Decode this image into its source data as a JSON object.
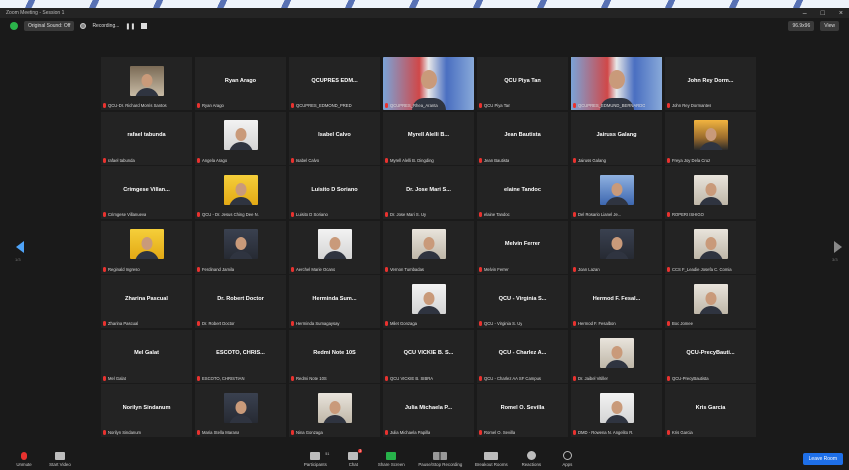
{
  "window": {
    "title": "Zoom Meeting - Session 1",
    "controls": [
      "–",
      "□",
      "×"
    ]
  },
  "toolbar_top": {
    "original_sound": "Original Sound: Off",
    "recording": "Recording...",
    "zoom_level": "96.9x96",
    "view": "View"
  },
  "nav": {
    "left_page": "1/3",
    "right_page": "3/3"
  },
  "tiles": [
    {
      "type": "photo",
      "style": "p-room",
      "label": "QCU-Dr. Richard Morris Santos"
    },
    {
      "type": "name",
      "name": "Ryan Arago",
      "label": "Ryan Arago"
    },
    {
      "type": "name",
      "name": "QCUPRES EDM...",
      "label": "QCUPRES_EDMOND_PRED"
    },
    {
      "type": "photo",
      "style": "p-seal",
      "label": "QCUPRES_Rhea_Aranta",
      "wide": true
    },
    {
      "type": "name",
      "name": "QCU Piya Tan",
      "label": "QCU Piya Tan"
    },
    {
      "type": "photo",
      "style": "p-seal",
      "label": "QCUPRES_EDMUND_BERNARDO",
      "wide": true,
      "active": true
    },
    {
      "type": "name",
      "name": "John Rey Dorm...",
      "label": "John Rey Dormantes"
    },
    {
      "type": "name",
      "name": "rafael tabunda",
      "label": "rafael tabunda"
    },
    {
      "type": "photo",
      "style": "p-white",
      "label": "Angela Arago"
    },
    {
      "type": "name",
      "name": "Isabel Calvo",
      "label": "Isabel Calvo"
    },
    {
      "type": "name",
      "name": "Myrell Alelli B...",
      "label": "Myrell Alelli B. Dingding"
    },
    {
      "type": "name",
      "name": "Jean Bautista",
      "label": "Jean Bautista"
    },
    {
      "type": "name",
      "name": "Jairuss Galang",
      "label": "Jairuss Galang"
    },
    {
      "type": "photo",
      "style": "p-sunset",
      "label": "Freya Joy Dela Cruz"
    },
    {
      "type": "name",
      "name": "Crimgese Villan...",
      "label": "Crimgese Villanueva"
    },
    {
      "type": "photo",
      "style": "p-yellow",
      "label": "QCU - Dr. Jesus Ching Dee N."
    },
    {
      "type": "name",
      "name": "Luisito D Soriano",
      "label": "Luisito D Soriano"
    },
    {
      "type": "name",
      "name": "Dr. Jose Mari S...",
      "label": "Dr. Jose Mari S. Uy"
    },
    {
      "type": "name",
      "name": "elaine Tandoc",
      "label": "elaine Tandoc"
    },
    {
      "type": "photo",
      "style": "p-blue",
      "label": "Del Rosario Lianel Je..."
    },
    {
      "type": "photo",
      "style": "p-light",
      "label": "ROPERI ISHIGO"
    },
    {
      "type": "photo",
      "style": "p-yellow",
      "label": "Reginald Ingreso"
    },
    {
      "type": "photo",
      "style": "p-dark",
      "label": "Ferdinand Jamila"
    },
    {
      "type": "photo",
      "style": "p-white",
      "label": "Aerchel Marie Ocano"
    },
    {
      "type": "photo",
      "style": "p-light",
      "label": "Vernon Tumbadas"
    },
    {
      "type": "name",
      "name": "Melvin Ferrer",
      "label": "Melvin Ferrer"
    },
    {
      "type": "photo",
      "style": "p-dark",
      "label": "Joan Lazan"
    },
    {
      "type": "photo",
      "style": "p-light",
      "label": "CCS F_Leadie Josefa C. Comia"
    },
    {
      "type": "name",
      "name": "Zharina Pascual",
      "label": "Zharina Pascual"
    },
    {
      "type": "name",
      "name": "Dr. Robert Doctor",
      "label": "Dr. Robert Doctor"
    },
    {
      "type": "name",
      "name": "Herminda Sum...",
      "label": "Herminda Sumagaysay"
    },
    {
      "type": "photo",
      "style": "p-white",
      "label": "Milet Gonzaga"
    },
    {
      "type": "name",
      "name": "QCU - Virginia S...",
      "label": "QCU - Virginia S. Uy"
    },
    {
      "type": "name",
      "name": "Hermod F. Fesal...",
      "label": "Hermod F. Fesalbon"
    },
    {
      "type": "photo",
      "style": "p-light",
      "label": "Boc Jomee"
    },
    {
      "type": "name",
      "name": "Mel Galat",
      "label": "Mel Galat"
    },
    {
      "type": "name",
      "name": "ESCOTO, CHRIS...",
      "label": "ESCOTO, CHRISTIAN"
    },
    {
      "type": "name",
      "name": "Redmi Note 10S",
      "label": "Redmi Note 10S"
    },
    {
      "type": "name",
      "name": "QCU VICKIE B. S...",
      "label": "QCU VICKIE B. SIBRA"
    },
    {
      "type": "name",
      "name": "QCU - Charlez A...",
      "label": "QCU - Charlez AA SF Campus"
    },
    {
      "type": "photo",
      "style": "p-light",
      "label": "Dr. Jaibel Vitiller"
    },
    {
      "type": "name",
      "name": "QCU-PrecyBauti...",
      "label": "QCU-PrecyBautista"
    },
    {
      "type": "name",
      "name": "Norilyn Sindanum",
      "label": "Norilyn Sindanum"
    },
    {
      "type": "photo",
      "style": "p-dark",
      "label": "Maria Stella Marana"
    },
    {
      "type": "photo",
      "style": "p-light",
      "label": "Nina Gonzaga"
    },
    {
      "type": "name",
      "name": "Julia Michaela P...",
      "label": "Julia Michaela Papilla"
    },
    {
      "type": "name",
      "name": "Romel O. Sevilla",
      "label": "Romel O. Sevilla"
    },
    {
      "type": "photo",
      "style": "p-white",
      "label": "DMD - Rowena N. Angelito R."
    },
    {
      "type": "name",
      "name": "Kris Garcia",
      "label": "Kris Garcia"
    }
  ],
  "toolbar": {
    "unmute": "Unmute",
    "start_video": "Start Video",
    "participants": "Participants",
    "participants_count": "51",
    "chat": "Chat",
    "chat_badge": "2",
    "share_screen": "Share Screen",
    "pause_recording": "Pause/Stop Recording",
    "breakout_rooms": "Breakout Rooms",
    "reactions": "Reactions",
    "apps": "Apps",
    "leave": "Leave Room"
  }
}
